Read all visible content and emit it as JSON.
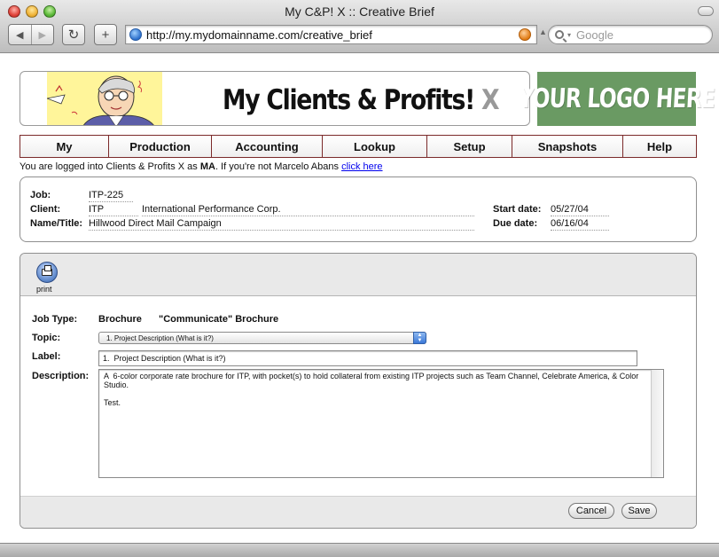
{
  "window": {
    "title": "My C&P! X :: Creative Brief",
    "url": "http://my.mydomainname.com/creative_brief",
    "search_placeholder": "Google",
    "back_glyph": "◀",
    "forward_glyph": "▶",
    "reload_glyph": "↻",
    "add_glyph": "+"
  },
  "banner": {
    "title_main": "My Clients & Profits! ",
    "title_x": "X",
    "logo_text": "YOUR LOGO HERE"
  },
  "menu": {
    "items": [
      "My",
      "Production",
      "Accounting",
      "Lookup",
      "Setup",
      "Snapshots",
      "Help"
    ]
  },
  "login": {
    "prefix": "You are logged into Clients & Profits X as ",
    "user_code": "MA",
    "middle": ". If you're not Marcelo Abans ",
    "link": "click here"
  },
  "job": {
    "job_label": "Job:",
    "job_value": "ITP-225",
    "client_label": "Client:",
    "client_code": "ITP",
    "client_name": "International Performance Corp.",
    "name_label": "Name/Title:",
    "name_value": "Hillwood Direct Mail Campaign",
    "start_label": "Start date:",
    "start_value": "05/27/04",
    "due_label": "Due date:",
    "due_value": "06/16/04"
  },
  "toolbar": {
    "print_label": "print"
  },
  "form": {
    "jobtype_label": "Job Type:",
    "jobtype_value": "Brochure",
    "jobtype_desc": "\"Communicate\" Brochure",
    "topic_label": "Topic:",
    "topic_value": "1. Project Description (What is it?)",
    "label_label": "Label:",
    "label_value": "1.  Project Description (What is it?)",
    "description_label": "Description:",
    "description_value": "A  6-color corporate rate brochure for ITP, with pocket(s) to hold collateral from existing ITP projects such as Team Channel, Celebrate America, & Color Studio.\n\nTest."
  },
  "buttons": {
    "cancel": "Cancel",
    "save": "Save"
  },
  "colors": {
    "menu_border": "#7b2a2a",
    "logo_bg": "#6a9a63",
    "link": "#0000ee"
  }
}
